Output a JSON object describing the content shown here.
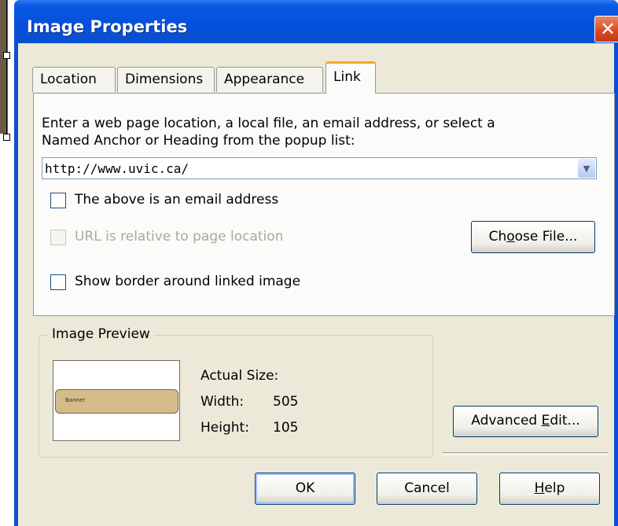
{
  "window": {
    "title": "Image Properties",
    "close_glyph": "✕"
  },
  "tabs": [
    {
      "label": "Location",
      "active": false
    },
    {
      "label": "Dimensions",
      "active": false
    },
    {
      "label": "Appearance",
      "active": false
    },
    {
      "label": "Link",
      "active": true
    }
  ],
  "link": {
    "instruction_line1": "Enter a web page location, a local file, an email address, or select a",
    "instruction_line2": "Named Anchor or Heading from the popup list:",
    "url_value": "http://www.uvic.ca/",
    "dropdown_glyph": "▼",
    "email_checkbox_label": "The above is an email address",
    "email_checked": false,
    "relative_checkbox_label": "URL is relative to page location",
    "relative_checked": false,
    "relative_enabled": false,
    "choose_file_prefix": "Ch",
    "choose_file_mnemonic": "o",
    "choose_file_suffix": "ose File...",
    "border_checkbox_label": "Show border around linked image",
    "border_checked": false
  },
  "preview": {
    "group_label": "Image Preview",
    "image_text": "Banner",
    "actual_size_label": "Actual Size:",
    "width_label": "Width:",
    "width_value": "505",
    "height_label": "Height:",
    "height_value": "105"
  },
  "buttons": {
    "advanced_prefix": "Advanced ",
    "advanced_mnemonic": "E",
    "advanced_suffix": "dit...",
    "ok": "OK",
    "cancel": "Cancel",
    "help_mnemonic": "H",
    "help_suffix": "elp"
  },
  "colors": {
    "titlebar": "#0550dc",
    "dialog_bg": "#ece9d8",
    "active_tab_accent": "#f6a827",
    "close_button": "#d9461f"
  },
  "icons": [
    "close-icon",
    "dropdown-arrow-icon",
    "checkbox"
  ]
}
